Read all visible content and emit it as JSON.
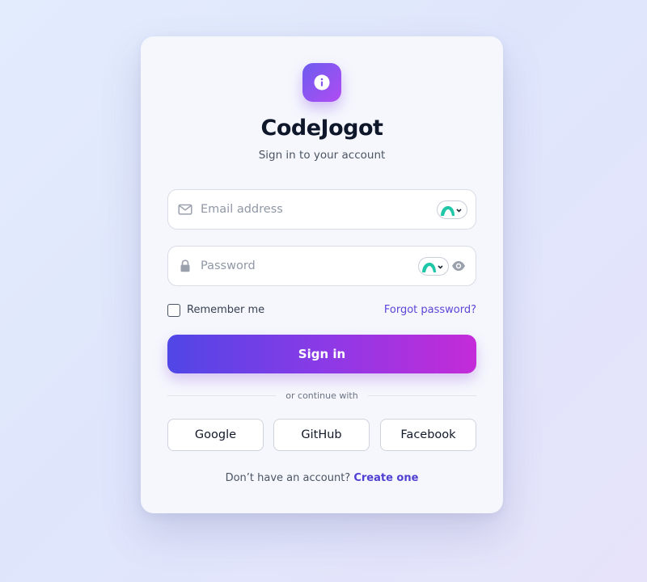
{
  "app": {
    "name": "CodeJogot",
    "subtitle": "Sign in to your account",
    "accent_color": "#6d5cf0",
    "logo_icon": "info-icon"
  },
  "form": {
    "email": {
      "placeholder": "Email address",
      "value": "",
      "icon": "mail-icon"
    },
    "password": {
      "placeholder": "Password",
      "value": "",
      "icon": "lock-icon",
      "toggle_icon": "eye-icon"
    },
    "password_manager_icon": "password-manager-icon",
    "remember_me": {
      "label": "Remember me",
      "checked": false
    },
    "forgot_password": "Forgot password?",
    "submit_label": "Sign in"
  },
  "social": {
    "divider": "or continue with",
    "providers": [
      "Google",
      "GitHub",
      "Facebook"
    ]
  },
  "footer": {
    "prompt": "Don’t have an account?",
    "link": "Create one"
  }
}
